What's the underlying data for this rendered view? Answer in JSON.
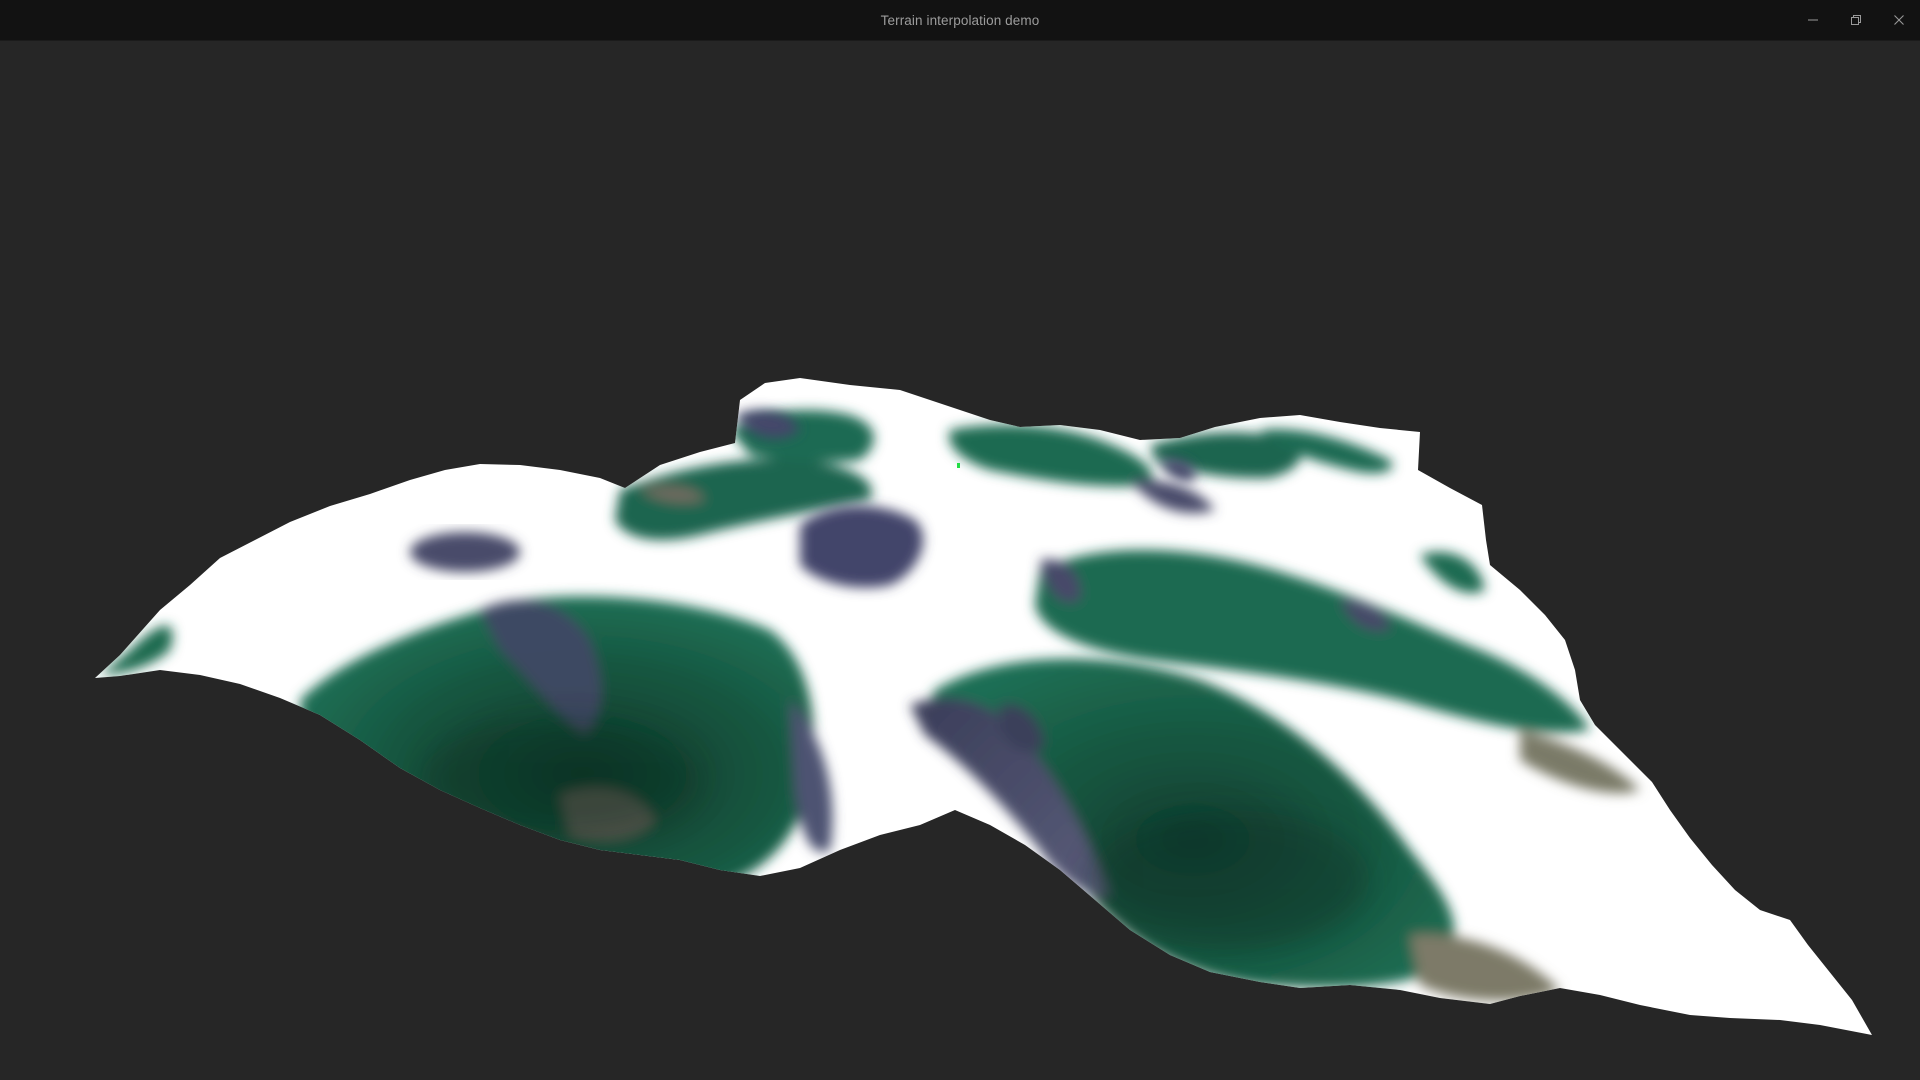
{
  "window": {
    "title": "Terrain interpolation demo",
    "controls": {
      "minimize_icon": "minimize-icon",
      "restore_icon": "restore-icon",
      "close_icon": "close-icon"
    }
  },
  "scene": {
    "background_color": "#262626",
    "palette": {
      "snow": "#ffffff",
      "forest": "#1d6b52",
      "forest_dark": "#0f3d2e",
      "rock": "#4f5270",
      "dirt": "#6f6c5c"
    },
    "cursor_marker_color": "#22dd44"
  }
}
